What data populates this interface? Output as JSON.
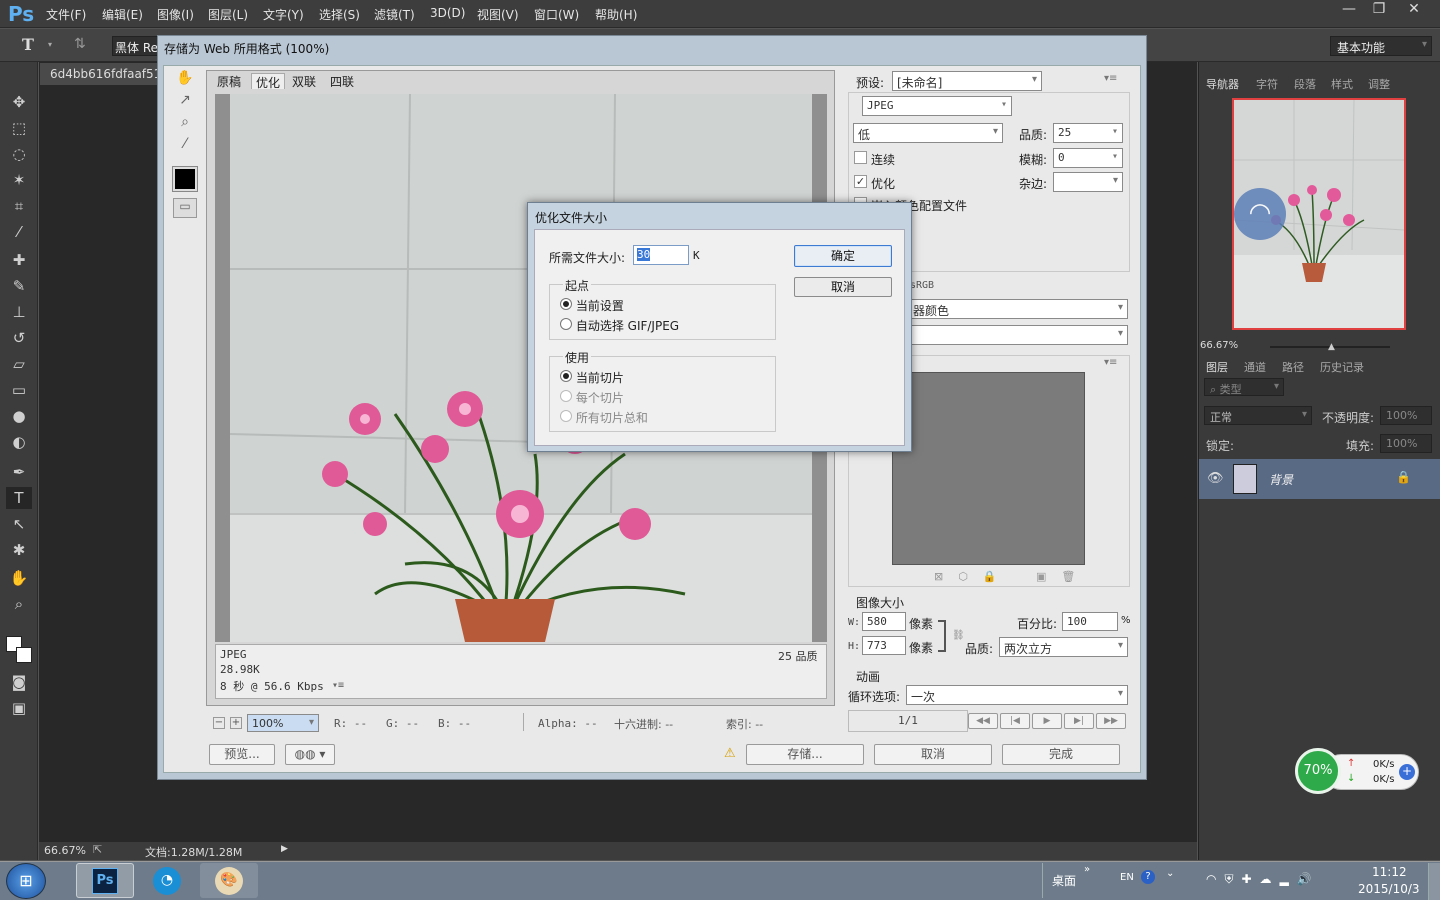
{
  "app": {
    "logo": "Ps",
    "menu": [
      "文件(F)",
      "编辑(E)",
      "图像(I)",
      "图层(L)",
      "文字(Y)",
      "选择(S)",
      "滤镜(T)",
      "3D(D)",
      "视图(V)",
      "窗口(W)",
      "帮助(H)"
    ],
    "window_buttons": [
      "—",
      "❐",
      "✕"
    ],
    "workspace": "基本功能",
    "font_family_field": "黑体 Re",
    "doc_tab": "6d4bb616fdfaaf51",
    "status_zoom": "66.67%",
    "status_doc": "文档:1.28M/1.28M"
  },
  "right_panels": {
    "top_tabs": [
      "导航器",
      "字符",
      "段落",
      "样式",
      "调整"
    ],
    "nav_zoom": "66.67%",
    "layer_tabs": [
      "图层",
      "通道",
      "路径",
      "历史记录"
    ],
    "filter_kind": "类型",
    "blend_mode": "正常",
    "opacity_label": "不透明度:",
    "opacity_value": "100%",
    "lock_label": "锁定:",
    "fill_label": "填充:",
    "fill_value": "100%",
    "layer_name": "背景"
  },
  "net_widget": {
    "percent": "70%",
    "up": "0K/s",
    "down": "0K/s"
  },
  "sfw": {
    "title": "存储为 Web 所用格式 (100%)",
    "tabs": [
      "原稿",
      "优化",
      "双联",
      "四联"
    ],
    "active_tab": "优化",
    "info": {
      "format": "JPEG",
      "size": "28.98K",
      "time": "8 秒 @ 56.6 Kbps",
      "quality": "25 品质"
    },
    "preset_label": "预设:",
    "preset_value": "[未命名]",
    "format_value": "JPEG",
    "quality_level": "低",
    "quality_label": "品质:",
    "quality_value": "25",
    "blur_label": "模糊:",
    "blur_value": "0",
    "matte_label": "杂边:",
    "progressive_label": "连续",
    "optimized_label": "优化",
    "embed_profile_label": "嵌入颜色配置文件",
    "srgb_label": "sRGB",
    "color_value": "器颜色",
    "image_size_label": "图像大小",
    "w_label": "W:",
    "w_value": "580",
    "h_label": "H:",
    "h_value": "773",
    "px_label": "像素",
    "percent_label": "百分比:",
    "percent_value": "100",
    "percent_unit": "%",
    "resample_label": "品质:",
    "resample_value": "两次立方",
    "anim_label": "动画",
    "loop_label": "循环选项:",
    "loop_value": "一次",
    "frame_counter": "1/1",
    "zoom_value": "100%",
    "readouts": {
      "r": "R: --",
      "g": "G: --",
      "b": "B: --",
      "alpha": "Alpha: --",
      "hex": "十六进制: --",
      "index": "索引: --"
    },
    "preview_button": "预览...",
    "save_button": "存储...",
    "cancel_button": "取消",
    "done_button": "完成"
  },
  "modal": {
    "title": "优化文件大小",
    "size_label": "所需文件大小:",
    "size_value": "30",
    "size_unit": "K",
    "ok": "确定",
    "cancel": "取消",
    "start_label": "起点",
    "start_options": [
      "当前设置",
      "自动选择 GIF/JPEG"
    ],
    "use_label": "使用",
    "use_options": [
      "当前切片",
      "每个切片",
      "所有切片总和"
    ]
  },
  "taskbar": {
    "desktop": "桌面",
    "lang": "EN",
    "time": "11:12",
    "date": "2015/10/3"
  }
}
